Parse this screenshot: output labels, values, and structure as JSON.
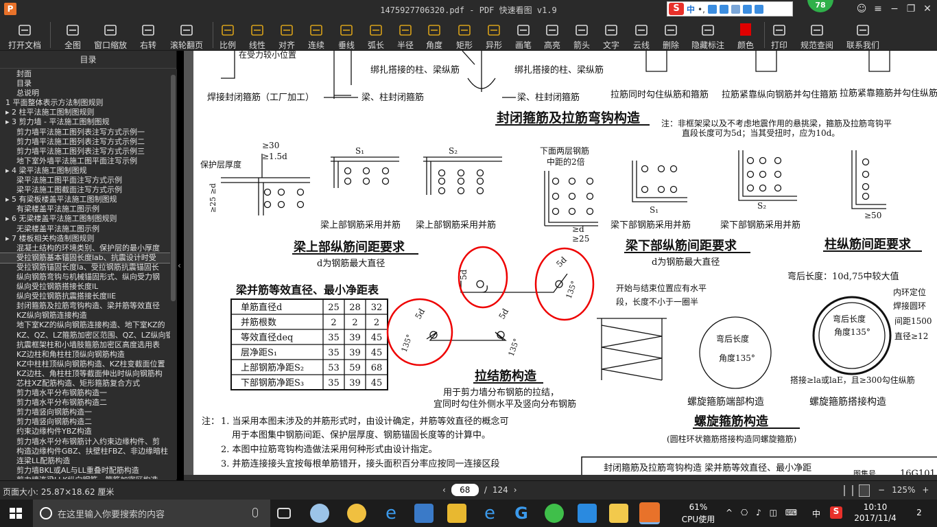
{
  "title": {
    "logo": "P",
    "text": "1475927706320.pdf - PDF 快速看图 v1.9",
    "badge": "78"
  },
  "ime": {
    "logo": "S",
    "mode": "中"
  },
  "toolbar": [
    {
      "id": "open",
      "label": "打开文档",
      "icon": "folder-icon"
    },
    {
      "id": "fit",
      "label": "全图",
      "icon": "fit-all-icon"
    },
    {
      "id": "zoom-window",
      "label": "窗口缩放",
      "icon": "magnifier-icon"
    },
    {
      "id": "rotate",
      "label": "右转",
      "icon": "rotate-right-icon"
    },
    {
      "id": "scroll-page",
      "label": "滚轮翻页",
      "icon": "mouse-wheel-icon"
    },
    {
      "id": "scale",
      "label": "比例",
      "icon": "ruler-icon"
    },
    {
      "id": "linear",
      "label": "线性",
      "icon": "linear-measure-icon"
    },
    {
      "id": "aligned",
      "label": "对齐",
      "icon": "aligned-measure-icon"
    },
    {
      "id": "continuous",
      "label": "连续",
      "icon": "continuous-measure-icon"
    },
    {
      "id": "perpendicular",
      "label": "垂线",
      "icon": "perpendicular-icon"
    },
    {
      "id": "arc",
      "label": "弧长",
      "icon": "arc-length-icon"
    },
    {
      "id": "radius",
      "label": "半径",
      "icon": "radius-icon"
    },
    {
      "id": "angle",
      "label": "角度",
      "icon": "angle-icon"
    },
    {
      "id": "rect",
      "label": "矩形",
      "icon": "rectangle-area-icon"
    },
    {
      "id": "poly",
      "label": "异形",
      "icon": "polygon-area-icon"
    },
    {
      "id": "pen",
      "label": "画笔",
      "icon": "pen-icon"
    },
    {
      "id": "highlight",
      "label": "高亮",
      "icon": "highlighter-icon"
    },
    {
      "id": "arrow",
      "label": "箭头",
      "icon": "arrow-icon"
    },
    {
      "id": "text",
      "label": "文字",
      "icon": "text-icon"
    },
    {
      "id": "cloud",
      "label": "云线",
      "icon": "cloud-line-icon"
    },
    {
      "id": "erase",
      "label": "删除",
      "icon": "eraser-icon"
    },
    {
      "id": "hide",
      "label": "隐藏标注",
      "icon": "eye-hide-icon"
    },
    {
      "id": "color",
      "label": "颜色",
      "icon": "color-swatch-icon"
    },
    {
      "id": "print",
      "label": "打印",
      "icon": "printer-icon"
    },
    {
      "id": "codes",
      "label": "规范查阅",
      "icon": "book-icon"
    },
    {
      "id": "contact",
      "label": "联系我们",
      "icon": "contact-icon"
    }
  ],
  "accent": {
    "color_swatch": "#e00000",
    "toolbar_icon": "#d8a11a"
  },
  "sidebar": {
    "title": "目录",
    "selected_index": 19,
    "items": [
      "封面",
      "目录",
      "总说明",
      "1 平面整体表示方法制图规则",
      "▸ 2 柱平法施工图制图规则",
      "▸ 3 剪力墙 - 平法施工图制图规",
      "剪力墙平法施工图列表注写方式示例一",
      "剪力墙平法施工图列表注写方式示例二",
      "剪力墙平法施工图列表注写方式示例三",
      "地下室外墙平法施工图平面注写示例",
      "▸ 4 梁平法施工图制图规",
      "梁平法施工图平面注写方式示例",
      "梁平法施工图截面注写方式示例",
      "▸ 5 有梁板楼盖平法施工图制图规",
      "有梁楼盖平法施工图示例",
      "▸ 6 无梁楼盖平法施工图制图规则",
      "无梁楼盖平法施工图示例",
      "▸ 7 楼板相关构造制图规则",
      "混凝土结构的环境类别、保护层的最小厚度",
      "受拉钢筋基本锚固长度lab、抗震设计时受",
      "受拉钢筋锚固长度la、受拉钢筋抗震锚固长",
      "纵向钢筋弯钩与机械锚固形式、纵向受力钢",
      "纵向受拉钢筋搭接长度lL",
      "纵向受拉钢筋抗震搭接长度llE",
      "封闭箍筋及拉筋弯钩构造、梁并筋等效直径",
      "KZ纵向钢筋连接构造",
      "地下室KZ的纵向钢筋连接构造、地下室KZ的",
      "KZ、QZ、LZ箍筋加密区范围、QZ、LZ纵向钢",
      "抗震框架柱和小墙肢箍筋加密区高度选用表",
      "KZ边柱和角柱柱顶纵向钢筋构造",
      "KZ中柱柱顶纵向钢筋构造、KZ柱变截面位置",
      "KZ边柱、角柱柱顶等截面伸出时纵向钢筋构",
      "芯柱XZ配筋构造、矩形箍筋复合方式",
      "剪力墙水平分布钢筋构造一",
      "剪力墙水平分布钢筋构造二",
      "剪力墙竖向钢筋构造一",
      "剪力墙竖向钢筋构造二",
      "约束边缘构件YBZ构造",
      "剪力墙水平分布钢筋计入约束边缘构件、剪",
      "构造边缘构件GBZ、扶壁柱FBZ、非边缘暗柱",
      "连梁LL配筋构造",
      "剪力墙BKL或AL与LL重叠时配筋构造",
      "剪力墙连梁LLK纵向钢筋、箍筋加密区构造"
    ]
  },
  "page": {
    "top": {
      "t0": "在受力较小位置",
      "t1": "绑扎搭接的柱、梁纵筋",
      "t2": "焊接封闭箍筋（工厂加工）",
      "t3": "梁、柱封闭箍筋",
      "t4": "绑扎搭接的柱、梁纵筋",
      "t5": "梁、柱封闭箍筋",
      "t6": "拉筋同时勾住纵筋和箍筋",
      "t7": "拉筋紧靠纵向钢筋并勾住箍筋",
      "t8": "拉筋紧靠箍筋并勾住纵筋"
    },
    "sec1_title": "封闭箍筋及拉筋弯钩构造",
    "sec1_note1": "注：非框架梁以及不考虑地震作用的悬挑梁，箍筋及拉筋弯钩平",
    "sec1_note2": "直段长度可为5d；当其受扭时，应为10d。",
    "beam_top": {
      "d1": "≥30",
      "d2": "≥1.5d",
      "cover": "保护层厚度",
      "d3": "≥25 ≥d"
    },
    "s1": "S₁",
    "s2": "S₂",
    "two_rows1": "下面两层钢筋",
    "two_rows2": "中距的2倍",
    "ge_d": "≥d",
    "ge_25": "≥25",
    "col50": "≥50",
    "cap_top1": "梁上部钢筋采用并筋",
    "cap_top2": "梁上部钢筋采用并筋",
    "cap_bot1": "梁下部钢筋采用并筋",
    "cap_bot2": "梁下部钢筋采用并筋",
    "title_top": "梁上部纵筋间距要求",
    "sub_top": "d为钢筋最大直径",
    "title_bot": "梁下部纵筋间距要求",
    "sub_bot": "d为钢筋最大直径",
    "title_col": "柱纵筋间距要求",
    "table_title": "梁并筋等效直径、最小净距表",
    "table": [
      [
        "单筋直径d",
        "25",
        "28",
        "32"
      ],
      [
        "并筋根数",
        "2",
        "2",
        "2"
      ],
      [
        "等效直径deq",
        "35",
        "39",
        "45"
      ],
      [
        "层净距S₁",
        "35",
        "39",
        "45"
      ],
      [
        "上部钢筋净距S₂",
        "53",
        "59",
        "68"
      ],
      [
        "下部钢筋净距S₃",
        "35",
        "39",
        "45"
      ]
    ],
    "d5": "5d",
    "a135": "135°",
    "tie_title": "拉结筋构造",
    "tie_note1": "用于剪力墙分布钢筋的拉结，",
    "tie_note2": "宜同时勾住外侧水平及竖向分布钢筋",
    "sp_n1": "开始与结束位置应有水平",
    "sp_n2": "段，长度不小于一圈半",
    "sp_bend": "弯后长度",
    "sp_angle": "角度135°",
    "sp_end": "螺旋箍筋端部构造",
    "sp_title": "螺旋箍筋构造",
    "sp_ring": "(圆柱环状箍筋搭接构造同螺旋箍筋)",
    "col_bend": "弯后长度：10d,75中较大值",
    "ring1": "内环定位",
    "ring2": "焊接圆环",
    "ring3": "间距1500",
    "ring4": "直径≥12",
    "ring_overlap": "搭接≥lа或laE，且≥300勾住纵筋",
    "ring_cap": "螺旋箍筋搭接构造",
    "notes_label": "注：",
    "note1a": "1. 当采用本图未涉及的并筋形式时，由设计确定，并筋等效直径的概念可",
    "note1b": "用于本图集中钢筋间距、保护层厚度、钢筋锚固长度等的计算中。",
    "note2": "2. 本图中拉筋弯钩构造做法采用何种形式由设计指定。",
    "note3": "3. 并筋连接接头宜按每根单筋错开，接头面积百分率应按同一连接区段",
    "tb_text": "封闭箍筋及拉筋弯钩构造  梁并筋等效直径、最小净距",
    "tb_label": "图集号",
    "tb_code": "16G101"
  },
  "status": {
    "page_size": "页面大小: 25.87×18.62 厘米",
    "page": "68",
    "sep": "/",
    "total": "124",
    "zoom": "125%"
  },
  "taskbar": {
    "search": "在这里输入你要搜索的内容",
    "cpu": "61%",
    "cpu_label": "CPU使用",
    "lang": "中",
    "time": "10:10",
    "date": "2017/11/4",
    "notif": "2"
  }
}
